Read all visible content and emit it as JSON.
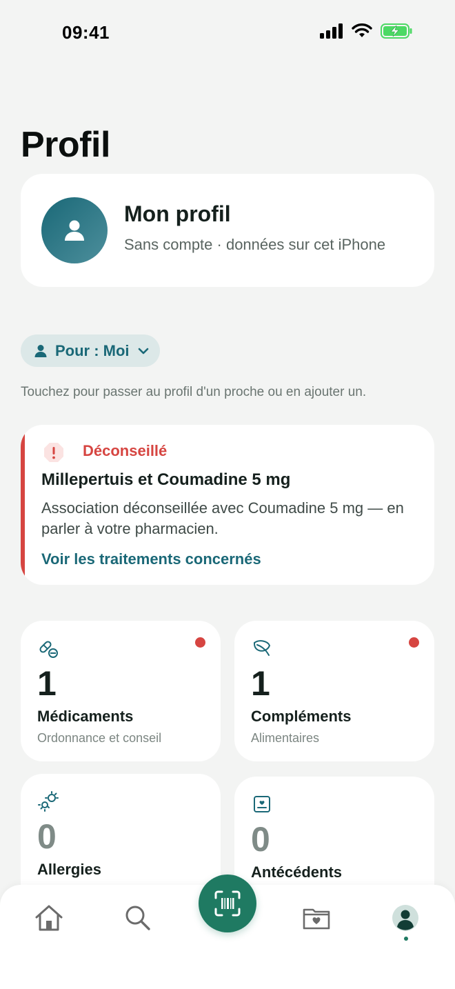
{
  "status_bar": {
    "time": "09:41"
  },
  "page": {
    "title": "Profil"
  },
  "profile": {
    "name": "Mon profil",
    "subtitle": "Sans compte · données sur cet iPhone"
  },
  "selector": {
    "label": "Pour : Moi",
    "hint": "Touchez pour passer au profil d'un proche ou en ajouter un."
  },
  "alert": {
    "tag": "Déconseillé",
    "title": "Millepertuis et Coumadine 5 mg",
    "body": "Association déconseillée avec Coumadine 5 mg — en parler à votre pharmacien.",
    "link": "Voir les traitements concernés",
    "color": "#d64541"
  },
  "stats": [
    {
      "count": "1",
      "label": "Médicaments",
      "sub": "Ordonnance et conseil",
      "icon": "pill-icon",
      "has_alert": true
    },
    {
      "count": "1",
      "label": "Compléments",
      "sub": "Alimentaires",
      "icon": "leaf-icon",
      "has_alert": true
    },
    {
      "count": "0",
      "label": "Allergies",
      "sub": "",
      "icon": "allergen-icon",
      "has_alert": false
    },
    {
      "count": "0",
      "label": "Antécédents",
      "sub": "",
      "icon": "medical-record-icon",
      "has_alert": false
    }
  ],
  "tab_bar": {
    "items": [
      "home-icon",
      "search-icon",
      "scan-barcode-icon",
      "health-folder-icon",
      "profile-icon"
    ],
    "active": "profile-icon"
  },
  "colors": {
    "accent": "#1a6877",
    "primary": "#1f7a62",
    "danger": "#d64541",
    "background": "#f3f4f3"
  }
}
